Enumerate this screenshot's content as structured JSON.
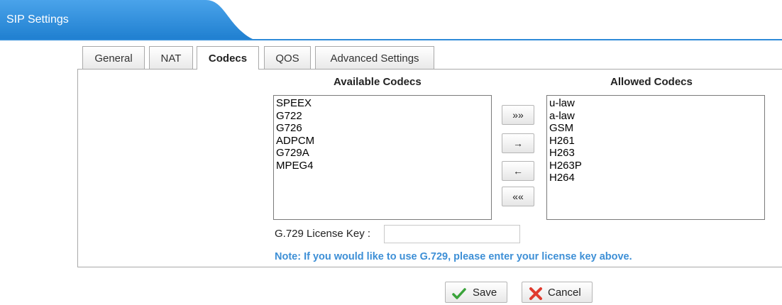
{
  "header": {
    "title": "SIP Settings"
  },
  "tabs": [
    {
      "label": "General",
      "active": false
    },
    {
      "label": "NAT",
      "active": false
    },
    {
      "label": "Codecs",
      "active": true
    },
    {
      "label": "QOS",
      "active": false
    },
    {
      "label": "Advanced Settings",
      "active": false
    }
  ],
  "codecs": {
    "available_heading": "Available Codecs",
    "allowed_heading": "Allowed Codecs",
    "available": [
      "SPEEX",
      "G722",
      "G726",
      "ADPCM",
      "G729A",
      "MPEG4"
    ],
    "allowed": [
      "u-law",
      "a-law",
      "GSM",
      "H261",
      "H263",
      "H263P",
      "H264"
    ],
    "move_all_right": "»»",
    "move_right": "→",
    "move_left": "←",
    "move_all_left": "««"
  },
  "license": {
    "label": "G.729 License Key :",
    "value": "",
    "note": "Note: If you would like to use G.729, please enter your license key above."
  },
  "actions": {
    "save": "Save",
    "cancel": "Cancel"
  },
  "colors": {
    "header_blue": "#2e8bd8",
    "note_blue": "#3d8fd6"
  }
}
